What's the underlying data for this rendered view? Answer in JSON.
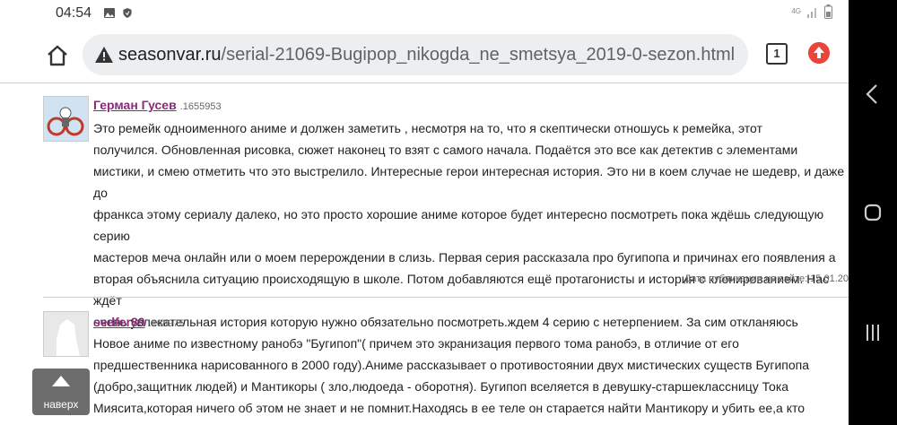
{
  "status_bar": {
    "time": "04:54",
    "network": "4G",
    "icons": [
      "image-icon",
      "shield-icon",
      "signal-icon",
      "battery-icon"
    ]
  },
  "browser": {
    "url_domain": "seasonvar.ru",
    "url_path": "/serial-21069-Bugipop_nikogda_ne_smetsya_2019-0-sezon.html",
    "tab_count": "1",
    "icons": [
      "home-icon",
      "warning-icon",
      "tabs-icon",
      "update-icon"
    ]
  },
  "comments": [
    {
      "author": "Герман Гусев",
      "post_id": ".1655953",
      "lines": [
        "Это ремейк одноименного аниме и должен заметить , несмотря на то, что я скептически отношусь к ремейка, этот",
        "получился. Обновленная рисовка, сюжет наконец то взят с самого начала. Подаётся это все как детектив с элементами",
        "мистики, и смею отметить что это выстрелило. Интересные герои интересная история. Это ни в коем случае не шедевр, и даже до",
        "франкса этому сериалу далеко, но это просто хорошие аниме которое будет интересно посмотреть пока ждёшь следующую серию",
        "мастеров меча онлайн или о моем перерождении в слизь. Первая серия рассказала про бугипопа и причинах его появления а",
        "вторая объяснила ситуацию происходящую в школе. Потом добавляются ещё протагонисты и история с клонированием. Нас ждёт",
        "очень увлекательная история которую нужно обязательно посмотреть.ждем 4 серию с нетерпением. За сим откланяюсь"
      ],
      "published": "Дата публикации на сайте: 15.01.20"
    },
    {
      "author": "sedfer89",
      "post_id": ".168975",
      "lines": [
        "Новое аниме по известному ранобэ \"Бугипоп\"( причем это экранизация первого тома ранобэ, в отличие от его",
        "предшественника нарисованного в 2000 году).Аниме рассказывает о противостоянии двух мистических существ Бугипопа",
        "(добро,защитник людей) и Мантикоры ( зло,людоеда - оборотня). Бугипоп вселяется в девушку-старшеклассницу Тока",
        "Миясита,которая ничего об этом не знает и не помнит.Находясь в ее теле он старается найти Мантикору и убить ее,а кто является"
      ]
    }
  ],
  "scroll_top": {
    "label": "наверх"
  },
  "nav_bar": {
    "icons": [
      "back-icon",
      "home-circle-icon",
      "recents-icon"
    ]
  }
}
